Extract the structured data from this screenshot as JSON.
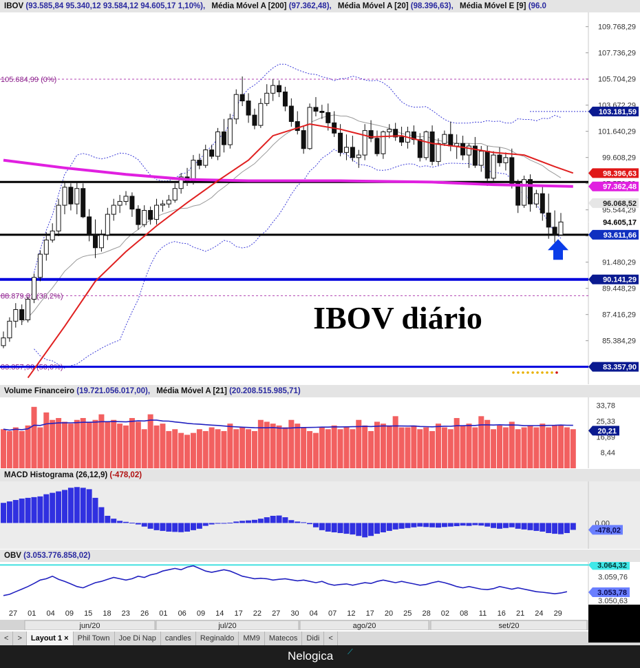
{
  "colors": {
    "candle_up": "#ffffff",
    "candle_down": "#111111",
    "sma200": "#e020e0",
    "sma20": "#e02020",
    "bollinger": "#3a3ad8",
    "support": "#000000",
    "blue_line": "#0000dd",
    "volume_bar": "#f26060",
    "macd_bar": "#3030e0",
    "obv_line": "#2020c0",
    "obv_ref": "#40e0e0"
  },
  "headers": {
    "price": {
      "symbol": "IBOV",
      "ohlc": "(93.585,84  95.340,12  93.584,12  94.605,17  1,10%),",
      "ind1_name": "Média Móvel A [200]",
      "ind1_val": "(97.362,48),",
      "ind2_name": "Média Móvel A [20]",
      "ind2_val": "(98.396,63),",
      "ind3_name": "Média Móvel E [9]",
      "ind3_val": "(96.0"
    },
    "volume": {
      "label": "Volume Financeiro",
      "value": "(19.721.056.017,00),",
      "ma_label": "Média Móvel A [21]",
      "ma_value": "(20.208.515.985,71)"
    },
    "macd": {
      "label": "MACD Histograma (26,12,9)",
      "value": "(-478,02)"
    },
    "obv": {
      "label": "OBV",
      "value": "(3.053.776.858,02)"
    }
  },
  "overlay_title": "IBOV diário",
  "fib_labels": [
    "105.684,99 (0%)",
    "88.879,81 (38,2%)",
    "83.357,90 (50,0%)"
  ],
  "buttons": {
    "prev": "<",
    "next": ">",
    "tab_prev": "<"
  },
  "tabs": [
    {
      "label": "Layout 1",
      "active": true
    },
    {
      "label": "Phil Town"
    },
    {
      "label": "Joe Di Nap"
    },
    {
      "label": "candles"
    },
    {
      "label": "Reginaldo"
    },
    {
      "label": "MM9"
    },
    {
      "label": "Matecos"
    },
    {
      "label": "Didi"
    }
  ],
  "tab_close": "×",
  "brand": "Nelogica",
  "chart_data": [
    {
      "type": "candlestick",
      "title": "IBOV",
      "y_ticks": [
        "109.768,29",
        "107.736,29",
        "105.704,29",
        "103.672,29",
        "101.640,29",
        "99.608,29",
        "97.576,29",
        "95.544,29",
        "93.512,29",
        "91.480,29",
        "89.448,29",
        "87.416,29",
        "85.384,29"
      ],
      "x_ticks": [
        "27",
        "01",
        "04",
        "09",
        "15",
        "18",
        "23",
        "26",
        "01",
        "06",
        "09",
        "14",
        "17",
        "22",
        "27",
        "30",
        "04",
        "07",
        "12",
        "17",
        "20",
        "25",
        "28",
        "02",
        "08",
        "11",
        "16",
        "21",
        "24",
        "29"
      ],
      "months": [
        "jun/20",
        "jul/20",
        "ago/20",
        "set/20"
      ],
      "ylim": [
        82000,
        110500
      ],
      "candles": [
        [
          85000,
          86100,
          84800,
          85600
        ],
        [
          85600,
          87200,
          85300,
          86900
        ],
        [
          86900,
          88300,
          86400,
          87800
        ],
        [
          87800,
          88200,
          86600,
          87000
        ],
        [
          87000,
          88800,
          86800,
          88600
        ],
        [
          88600,
          90600,
          88300,
          90300
        ],
        [
          90300,
          92400,
          90000,
          92100
        ],
        [
          92100,
          93800,
          91600,
          93200
        ],
        [
          93200,
          94500,
          93000,
          93900
        ],
        [
          93900,
          96400,
          93500,
          95900
        ],
        [
          95900,
          97800,
          95200,
          97300
        ],
        [
          97300,
          97600,
          95500,
          96000
        ],
        [
          96000,
          97700,
          95200,
          97200
        ],
        [
          97200,
          97600,
          94900,
          95000
        ],
        [
          95000,
          95600,
          93100,
          93600
        ],
        [
          93600,
          94800,
          91800,
          92600
        ],
        [
          92600,
          94000,
          92300,
          93600
        ],
        [
          93600,
          95700,
          93200,
          95200
        ],
        [
          95200,
          96400,
          94700,
          95900
        ],
        [
          95900,
          96700,
          95300,
          96200
        ],
        [
          96200,
          97000,
          95900,
          96600
        ],
        [
          96600,
          96900,
          95000,
          95600
        ],
        [
          95600,
          95900,
          94000,
          94400
        ],
        [
          94400,
          95900,
          94200,
          95500
        ],
        [
          95500,
          95800,
          94400,
          94800
        ],
        [
          94800,
          96400,
          94400,
          95900
        ],
        [
          95900,
          96300,
          95400,
          96000
        ],
        [
          96000,
          96700,
          95700,
          96300
        ],
        [
          96300,
          97600,
          96100,
          97200
        ],
        [
          97200,
          98400,
          96800,
          98100
        ],
        [
          98100,
          98800,
          97400,
          97800
        ],
        [
          97800,
          99800,
          97500,
          99400
        ],
        [
          99400,
          99900,
          98700,
          99000
        ],
        [
          99000,
          100600,
          98800,
          100200
        ],
        [
          100200,
          100600,
          99500,
          99700
        ],
        [
          99700,
          101900,
          99400,
          101600
        ],
        [
          101600,
          102600,
          100000,
          100600
        ],
        [
          100600,
          103000,
          100300,
          102600
        ],
        [
          102600,
          104900,
          102200,
          104500
        ],
        [
          104500,
          105900,
          103600,
          104000
        ],
        [
          104000,
          104600,
          102300,
          102900
        ],
        [
          102900,
          103400,
          101800,
          102100
        ],
        [
          102100,
          104200,
          101900,
          103800
        ],
        [
          103800,
          105300,
          103600,
          104600
        ],
        [
          104600,
          105700,
          104000,
          105200
        ],
        [
          105200,
          105600,
          104300,
          104700
        ],
        [
          104700,
          105100,
          103200,
          103600
        ],
        [
          103600,
          104200,
          102000,
          102400
        ],
        [
          102400,
          103200,
          101400,
          101700
        ],
        [
          101700,
          102100,
          99900,
          100300
        ],
        [
          100300,
          103800,
          100200,
          103500
        ],
        [
          103500,
          104300,
          102800,
          103200
        ],
        [
          103200,
          103700,
          102600,
          103100
        ],
        [
          103100,
          103800,
          101700,
          102300
        ],
        [
          102300,
          103200,
          101200,
          101500
        ],
        [
          101500,
          102200,
          99700,
          100000
        ],
        [
          100000,
          101400,
          99400,
          100400
        ],
        [
          100400,
          101300,
          99300,
          99600
        ],
        [
          99600,
          100200,
          98800,
          99800
        ],
        [
          99800,
          102200,
          99400,
          101700
        ],
        [
          101700,
          102500,
          100800,
          101100
        ],
        [
          101100,
          101700,
          99700,
          99900
        ],
        [
          99900,
          101700,
          99500,
          101600
        ],
        [
          101600,
          102200,
          101100,
          101800
        ],
        [
          101800,
          102300,
          100900,
          101200
        ],
        [
          101200,
          102000,
          100500,
          100800
        ],
        [
          100800,
          102000,
          100300,
          101600
        ],
        [
          101600,
          102100,
          100600,
          101000
        ],
        [
          101000,
          101500,
          99300,
          99600
        ],
        [
          99600,
          101700,
          99400,
          101600
        ],
        [
          101600,
          102100,
          99000,
          99300
        ],
        [
          99300,
          101100,
          99000,
          100700
        ],
        [
          100700,
          101700,
          100500,
          101400
        ],
        [
          101400,
          102400,
          100100,
          100500
        ],
        [
          100500,
          101400,
          99500,
          100700
        ],
        [
          100700,
          101300,
          99400,
          99800
        ],
        [
          99800,
          100700,
          98800,
          100500
        ],
        [
          100500,
          101200,
          98800,
          99000
        ],
        [
          99000,
          100500,
          98500,
          100100
        ],
        [
          100100,
          100500,
          97400,
          98000
        ],
        [
          98000,
          100100,
          97800,
          99800
        ],
        [
          99800,
          100400,
          98900,
          99200
        ],
        [
          99200,
          100000,
          98600,
          99600
        ],
        [
          99600,
          100300,
          97200,
          97600
        ],
        [
          97600,
          97900,
          95300,
          95900
        ],
        [
          95900,
          98200,
          95700,
          97900
        ],
        [
          97900,
          98300,
          95400,
          96000
        ],
        [
          96000,
          97100,
          95700,
          96800
        ],
        [
          96800,
          97400,
          94700,
          95300
        ],
        [
          95300,
          96800,
          93300,
          94200
        ],
        [
          94200,
          95500,
          93000,
          93600
        ],
        [
          93600,
          95300,
          93600,
          94600
        ]
      ],
      "series": [
        {
          "name": "Média Móvel A [200]",
          "values": [
            [
              0,
              99400
            ],
            [
              10,
              98800
            ],
            [
              20,
              98300
            ],
            [
              30,
              97900
            ],
            [
              40,
              97800
            ],
            [
              55,
              97800
            ],
            [
              70,
              97700
            ],
            [
              80,
              97500
            ],
            [
              93,
              97360
            ]
          ]
        },
        {
          "name": "Média Móvel A [20]",
          "values": [
            [
              4,
              82500
            ],
            [
              10,
              86500
            ],
            [
              15,
              90000
            ],
            [
              20,
              92300
            ],
            [
              25,
              94300
            ],
            [
              30,
              96100
            ],
            [
              35,
              97800
            ],
            [
              40,
              99400
            ],
            [
              44,
              101300
            ],
            [
              50,
              102200
            ],
            [
              55,
              101800
            ],
            [
              60,
              101200
            ],
            [
              65,
              101300
            ],
            [
              70,
              100700
            ],
            [
              75,
              100400
            ],
            [
              80,
              100000
            ],
            [
              85,
              99800
            ],
            [
              90,
              98900
            ],
            [
              93,
              98400
            ]
          ]
        }
      ],
      "lines": [
        {
          "label": "103.181,59",
          "value": 103181.59
        },
        {
          "label": "97.705,16",
          "value": 97705.16
        },
        {
          "label": "93.611,66",
          "value": 93611.66
        },
        {
          "label": "90.141,29",
          "value": 90141.29
        },
        {
          "label": "83.357,90",
          "value": 83357.9
        }
      ],
      "price_labels": [
        {
          "label": "98.396,63",
          "value": 98396.63
        },
        {
          "label": "97.362,48",
          "value": 97362.48
        },
        {
          "label": "96.068,52",
          "value": 96068.52
        },
        {
          "label": "94.605,17",
          "value": 94605.17
        },
        {
          "label": "93.611,66",
          "value": 93611.66
        },
        {
          "label": "90.141,29",
          "value": 90141.29
        },
        {
          "label": "83.357,90",
          "value": 83357.9
        },
        {
          "label": "103.181,59",
          "value": 103181.59
        }
      ],
      "fib_levels": [
        105684.99,
        88879.81,
        83357.9
      ]
    },
    {
      "type": "bar",
      "title": "Volume Financeiro",
      "y_ticks": [
        "33,78",
        "25,33",
        "16,89",
        "8,44"
      ],
      "ylim": [
        0,
        37
      ],
      "ma_label": "20,21",
      "ma_value": 20.21,
      "values": [
        21,
        20,
        22,
        20,
        23,
        33,
        22,
        30,
        26,
        27,
        25,
        24,
        26,
        27,
        25,
        26,
        29,
        25,
        26,
        24,
        23,
        27,
        25,
        21,
        29,
        23,
        24,
        20,
        21,
        19,
        18,
        19,
        21,
        20,
        22,
        21,
        20,
        24,
        21,
        22,
        21,
        20,
        26,
        25,
        24,
        23,
        22,
        26,
        24,
        22,
        20,
        19,
        22,
        21,
        23,
        21,
        22,
        21,
        26,
        23,
        20,
        25,
        24,
        23,
        28,
        22,
        22,
        23,
        21,
        22,
        20,
        24,
        22,
        21,
        27,
        23,
        24,
        22,
        28,
        26,
        21,
        23,
        22,
        25,
        21,
        22,
        23,
        22,
        24,
        22,
        23,
        23,
        22,
        21
      ]
    },
    {
      "type": "bar",
      "title": "MACD Histograma (26,12,9)",
      "y_ticks": [
        "0,00"
      ],
      "ylim": [
        -1800,
        2800
      ],
      "value_label": "-478,02",
      "values": [
        1400,
        1500,
        1600,
        1700,
        1750,
        1800,
        1850,
        2000,
        2100,
        2200,
        2300,
        2450,
        2500,
        2450,
        2350,
        1750,
        1100,
        500,
        300,
        150,
        80,
        20,
        -100,
        -250,
        -400,
        -500,
        -550,
        -600,
        -620,
        -640,
        -600,
        -500,
        -400,
        -200,
        -100,
        -50,
        -20,
        20,
        100,
        150,
        180,
        220,
        300,
        400,
        500,
        520,
        400,
        200,
        100,
        50,
        -80,
        -300,
        -500,
        -600,
        -650,
        -700,
        -750,
        -800,
        -900,
        -1000,
        -900,
        -750,
        -650,
        -550,
        -450,
        -400,
        -350,
        -300,
        -250,
        -280,
        -300,
        -320,
        -280,
        -250,
        -220,
        -180,
        -200,
        -150,
        -180,
        -250,
        -350,
        -400,
        -350,
        -300,
        -400,
        -450,
        -500,
        -550,
        -600,
        -700,
        -750,
        -780,
        -700,
        -478
      ]
    },
    {
      "type": "line",
      "title": "OBV",
      "y_ticks": [
        "3.059,76",
        "3.050,63"
      ],
      "ylim": [
        3049,
        3065.5
      ],
      "ref_label": "3.064,32",
      "ref_value": 3064.32,
      "last_label": "3.053,78",
      "last_value": 3053.78,
      "values": [
        3052.5,
        3053.0,
        3054.0,
        3055.0,
        3056.0,
        3057.2,
        3058.5,
        3059.0,
        3060.0,
        3058.8,
        3058.0,
        3057.0,
        3056.0,
        3055.5,
        3056.5,
        3057.5,
        3058.0,
        3058.8,
        3059.5,
        3059.0,
        3058.5,
        3059.0,
        3060.0,
        3059.5,
        3060.5,
        3061.0,
        3062.0,
        3062.5,
        3063.0,
        3062.5,
        3063.5,
        3064.0,
        3063.0,
        3062.0,
        3061.5,
        3062.0,
        3062.5,
        3062.0,
        3061.0,
        3060.0,
        3059.5,
        3059.0,
        3059.2,
        3059.0,
        3058.5,
        3058.8,
        3059.0,
        3058.6,
        3058.2,
        3058.5,
        3058.0,
        3057.5,
        3058.0,
        3057.0,
        3056.5,
        3056.8,
        3057.0,
        3056.5,
        3057.0,
        3057.5,
        3057.2,
        3058.0,
        3058.5,
        3058.0,
        3057.5,
        3058.0,
        3057.5,
        3057.0,
        3056.5,
        3056.8,
        3057.5,
        3058.0,
        3057.5,
        3056.8,
        3056.0,
        3055.5,
        3056.0,
        3055.5,
        3055.0,
        3054.8,
        3055.2,
        3056.0,
        3055.5,
        3055.0,
        3055.5,
        3055.0,
        3054.5,
        3054.0,
        3053.8,
        3053.5,
        3053.2,
        3053.5,
        3054.0
      ]
    }
  ]
}
